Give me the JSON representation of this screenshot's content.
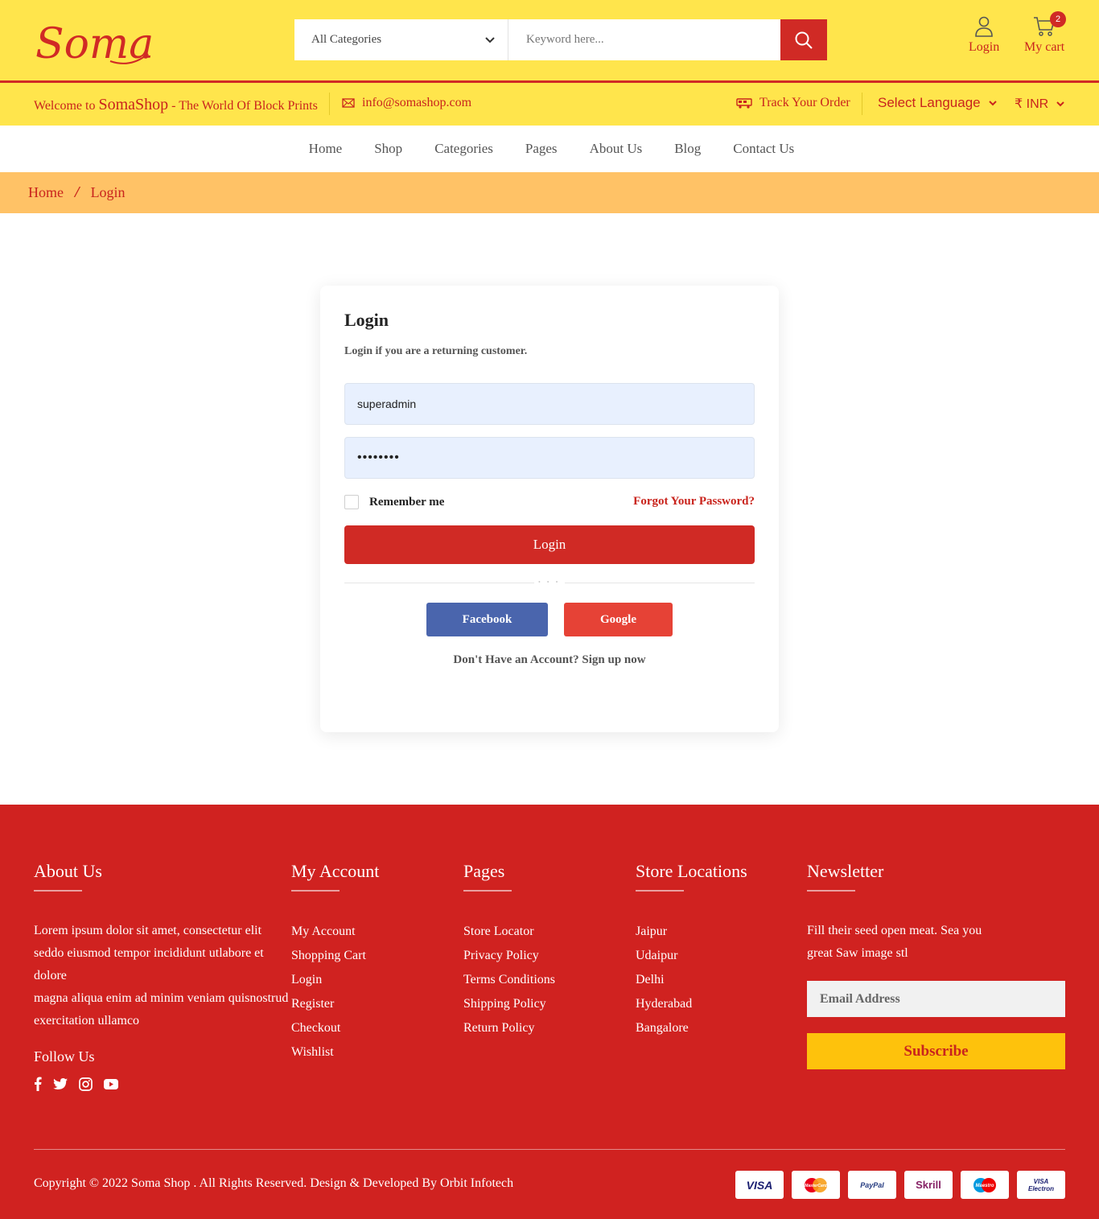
{
  "header": {
    "logo_text": "Soma",
    "search_category": "All Categories",
    "search_placeholder": "Keyword here...",
    "login_label": "Login",
    "cart_label": "My cart",
    "cart_count": "2"
  },
  "subbar": {
    "welcome_prefix": "Welcome to",
    "welcome_brand": "SomaShop",
    "welcome_suffix": "- The World Of Block Prints",
    "email": "info@somashop.com",
    "track_order": "Track Your Order",
    "language": "Select Language",
    "currency": "₹ INR"
  },
  "nav": [
    "Home",
    "Shop",
    "Categories",
    "Pages",
    "About Us",
    "Blog",
    "Contact Us"
  ],
  "breadcrumb": {
    "home": "Home",
    "current": "Login"
  },
  "login": {
    "title": "Login",
    "subtitle": "Login if you are a returning customer.",
    "username_value": "superadmin",
    "password_value": "••••••••",
    "remember_label": "Remember me",
    "forgot_label": "Forgot Your Password?",
    "submit_label": "Login",
    "facebook_label": "Facebook",
    "google_label": "Google",
    "signup_text": "Don't Have an Account? Sign up now"
  },
  "footer": {
    "about": {
      "title": "About Us",
      "text_1": "Lorem ipsum dolor sit amet, consectetur elit seddo eiusmod tempor incididunt utlabore et dolore",
      "text_2": "magna aliqua enim ad minim veniam quisnostrud exercitation ullamco",
      "follow_title": "Follow Us"
    },
    "my_account": {
      "title": "My Account",
      "items": [
        "My Account",
        "Shopping Cart",
        "Login",
        "Register",
        "Checkout",
        "Wishlist"
      ]
    },
    "pages": {
      "title": "Pages",
      "items": [
        "Store Locator",
        "Privacy Policy",
        "Terms Conditions",
        "Shipping Policy",
        "Return Policy"
      ]
    },
    "stores": {
      "title": "Store Locations",
      "items": [
        "Jaipur",
        "Udaipur",
        "Delhi",
        "Hyderabad",
        "Bangalore"
      ]
    },
    "newsletter": {
      "title": "Newsletter",
      "text": "Fill their seed open meat. Sea you great Saw image stl",
      "email_placeholder": "Email Address",
      "subscribe_label": "Subscribe"
    },
    "copyright": "Copyright © 2022 Soma Shop . All Rights Reserved. Design & Developed By Orbit Infotech",
    "payments": [
      "VISA",
      "MasterCard",
      "PayPal",
      "Skrill",
      "Maestro",
      "VISA Electron"
    ]
  },
  "colors": {
    "primary_red": "#d02a25",
    "header_yellow": "#ffe54c",
    "breadcrumb_orange": "#ffc266",
    "subscribe_yellow": "#fec20c",
    "facebook_blue": "#4a65ad",
    "google_red": "#e64236"
  }
}
